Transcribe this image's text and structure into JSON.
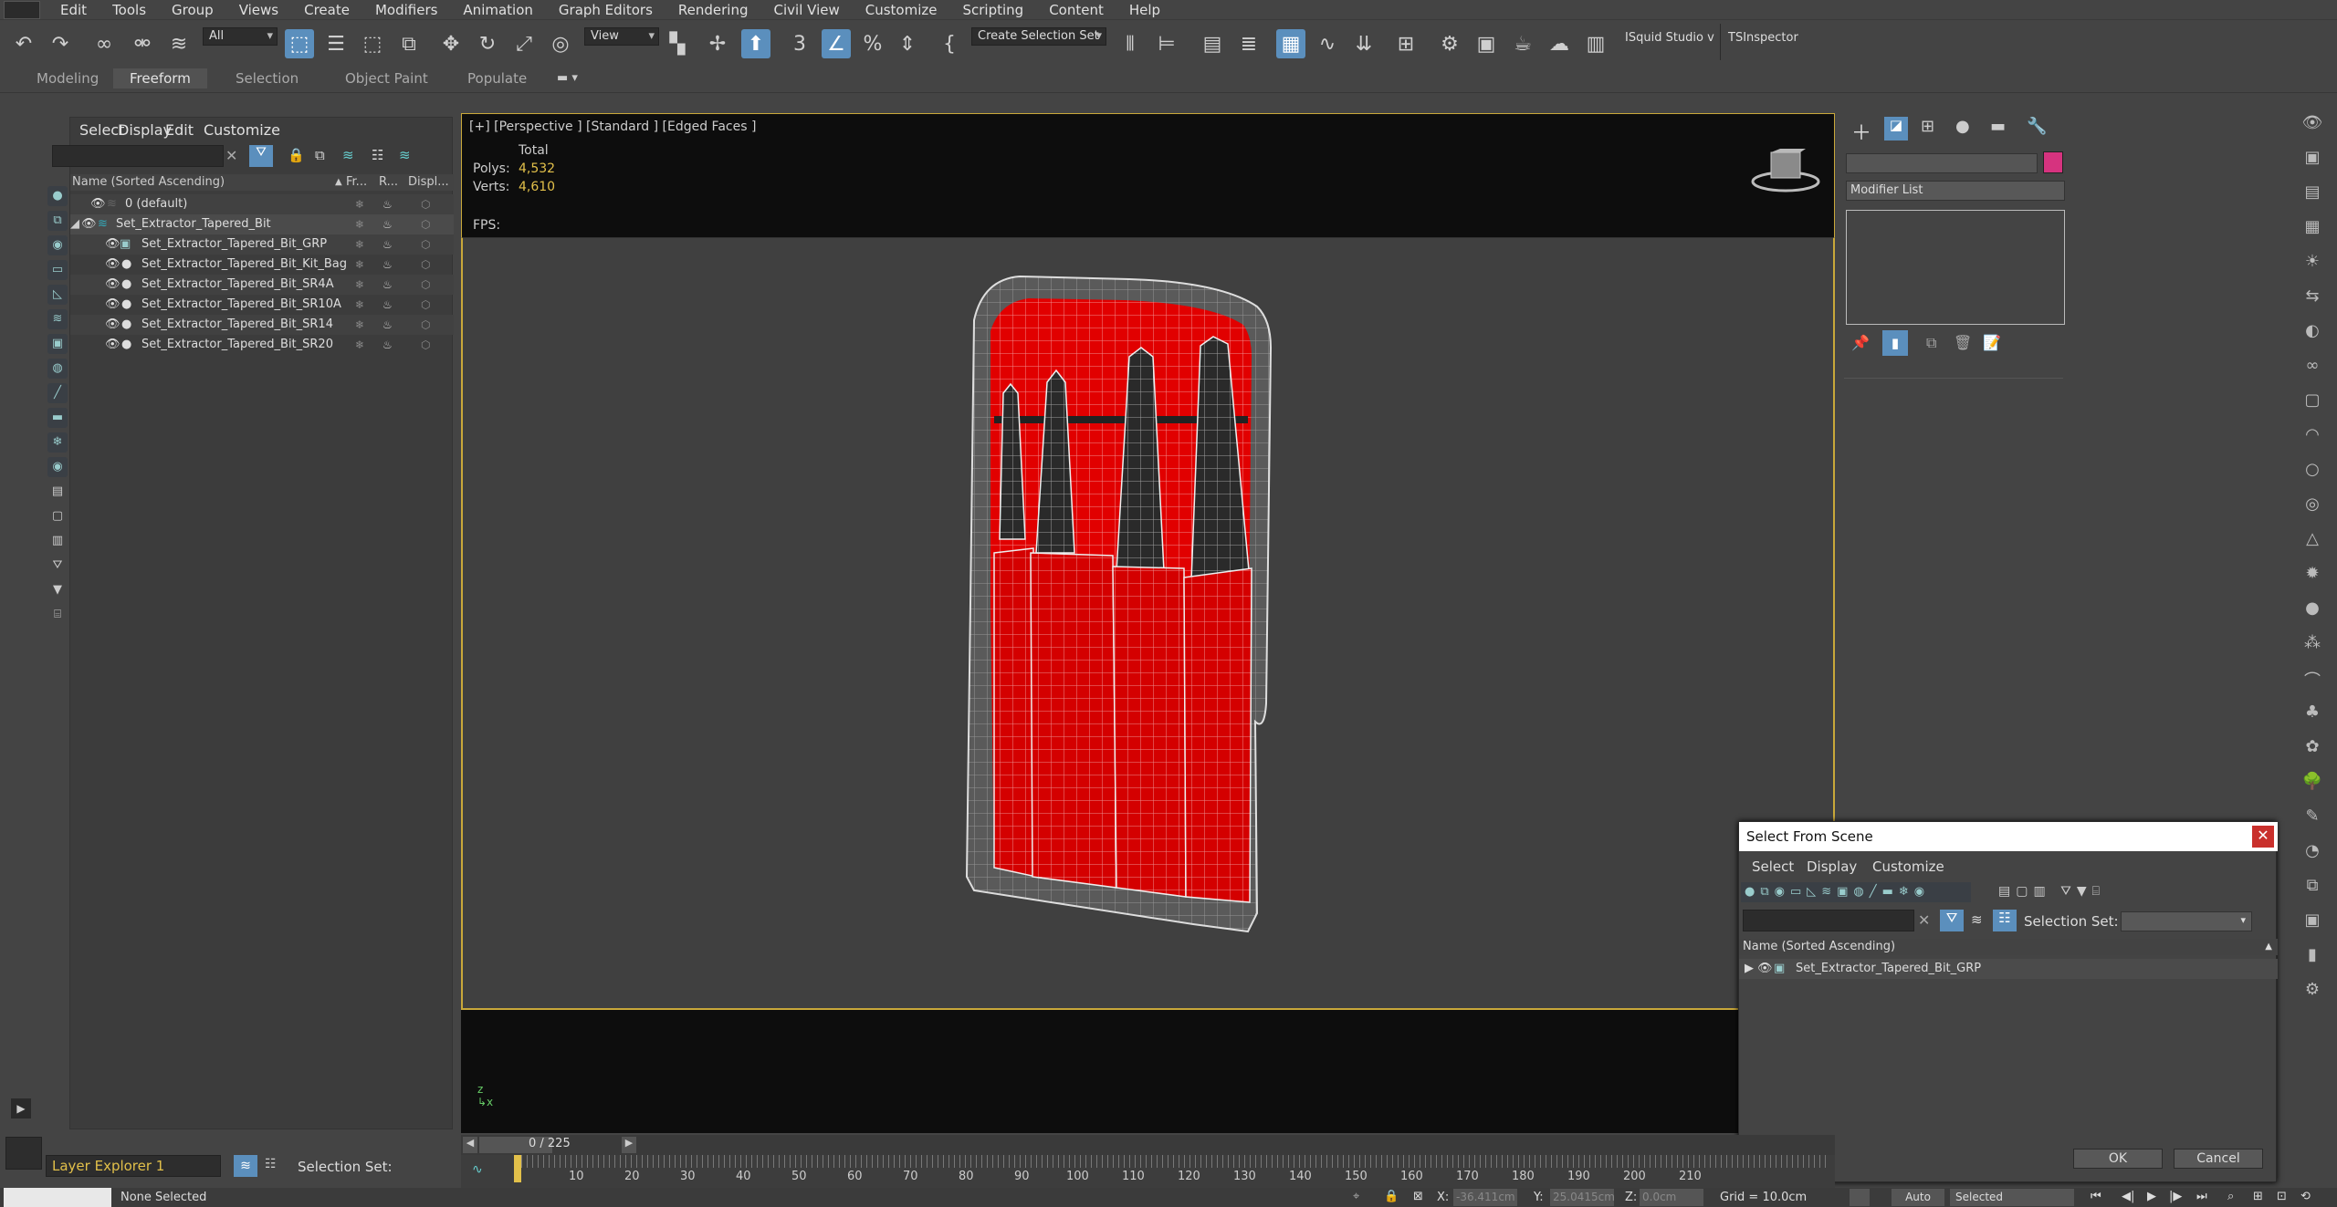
{
  "menu": [
    "Edit",
    "Tools",
    "Group",
    "Views",
    "Create",
    "Modifiers",
    "Animation",
    "Graph Editors",
    "Rendering",
    "Civil View",
    "Customize",
    "Scripting",
    "Content",
    "Help"
  ],
  "toolbar": {
    "filter": "All",
    "refcoord": "View",
    "selection_set": "Create Selection Set",
    "plugin1": "ISquid Studio v",
    "plugin2": "TSInspector"
  },
  "ribbon_tabs": [
    "Modeling",
    "Freeform",
    "Selection",
    "Object Paint",
    "Populate"
  ],
  "scene_explorer": {
    "menu": [
      "Select",
      "Display",
      "Edit",
      "Customize"
    ],
    "columns": [
      "Name (Sorted Ascending)",
      "Fr...",
      "R...",
      "Displ..."
    ],
    "rows": [
      {
        "name": "0 (default)"
      },
      {
        "name": "Set_Extractor_Tapered_Bit"
      },
      {
        "name": "Set_Extractor_Tapered_Bit_GRP"
      },
      {
        "name": "Set_Extractor_Tapered_Bit_Kit_Bag"
      },
      {
        "name": "Set_Extractor_Tapered_Bit_SR4A"
      },
      {
        "name": "Set_Extractor_Tapered_Bit_SR10A"
      },
      {
        "name": "Set_Extractor_Tapered_Bit_SR14"
      },
      {
        "name": "Set_Extractor_Tapered_Bit_SR20"
      }
    ],
    "layer": "Layer Explorer 1",
    "selection_set_label": "Selection Set:"
  },
  "viewport": {
    "label": "[+] [Perspective ] [Standard ] [Edged Faces ]",
    "total": "Total",
    "polys_label": "Polys:",
    "polys": "4,532",
    "verts_label": "Verts:",
    "verts": "4,610",
    "fps_label": "FPS:"
  },
  "command_panel": {
    "modifier_list": "Modifier List",
    "color": "#d6337f"
  },
  "select_from_scene": {
    "title": "Select From Scene",
    "menu": [
      "Select",
      "Display",
      "Customize"
    ],
    "selection_set": "Selection Set:",
    "column": "Name (Sorted Ascending)",
    "row": "Set_Extractor_Tapered_Bit_GRP",
    "ok": "OK",
    "cancel": "Cancel"
  },
  "timeline": {
    "frame": "0 / 225",
    "ticks": [
      "10",
      "20",
      "30",
      "40",
      "50",
      "60",
      "70",
      "80",
      "90",
      "100",
      "110",
      "120",
      "130",
      "140",
      "150",
      "160",
      "170",
      "180",
      "190",
      "200",
      "210"
    ]
  },
  "status": {
    "selection": "None Selected",
    "x_label": "X:",
    "x": "-36.411cm",
    "y_label": "Y:",
    "y": "25.0415cm",
    "z_label": "Z:",
    "z": "0.0cm",
    "grid": "Grid = 10.0cm",
    "auto": "Auto",
    "selected": "Selected"
  },
  "colors": {
    "accent": "#5b8fbd",
    "viewport_border": "#c9a83a",
    "bag_red": "#e10000",
    "close_red": "#c9302c"
  }
}
